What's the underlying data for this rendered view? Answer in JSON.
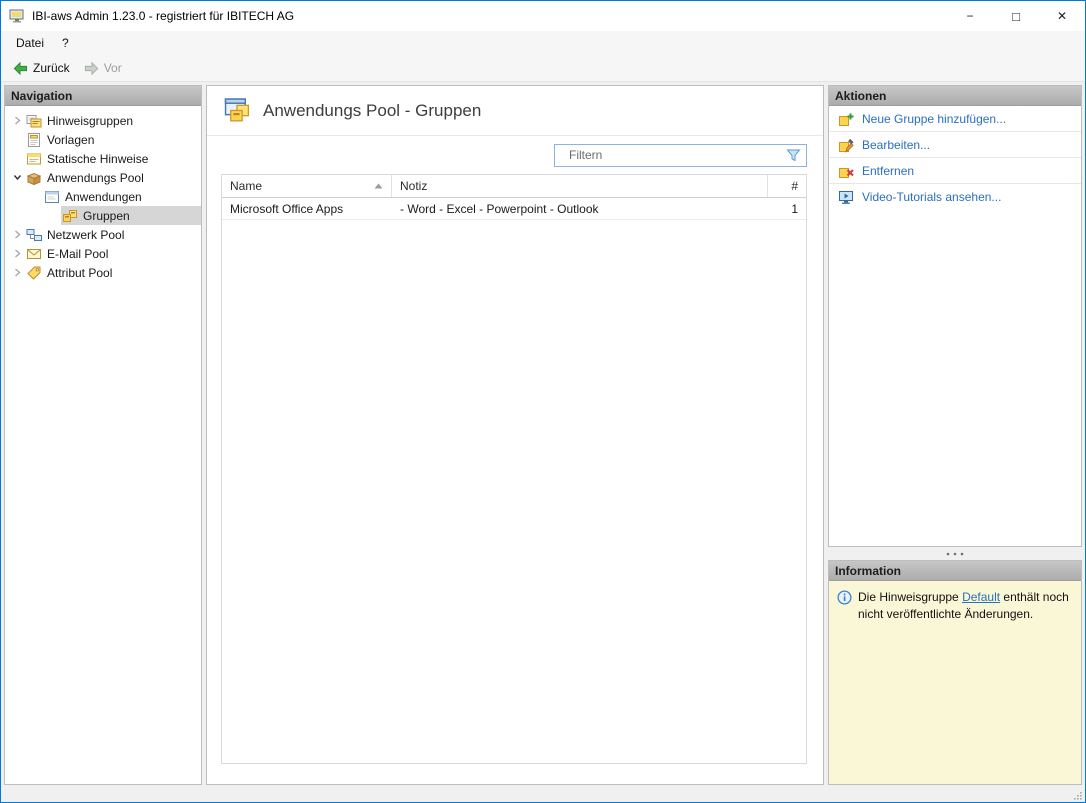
{
  "colors": {
    "window_border": "#0078d7",
    "panel_header_bg": "#b8b8b8",
    "selection_bg": "#d6d6d6",
    "link_blue": "#2a6fc0",
    "info_panel_bg": "#faf7d7",
    "back_arrow_green": "#3fae49",
    "filter_border_blue": "#8cb2dd"
  },
  "window": {
    "title": "IBI-aws Admin 1.23.0 - registriert für IBITECH AG",
    "controls": [
      {
        "name": "minimize",
        "glyph": "−"
      },
      {
        "name": "maximize",
        "glyph": "□"
      },
      {
        "name": "close",
        "glyph": "✕"
      }
    ]
  },
  "menubar": {
    "items": [
      {
        "label": "Datei"
      },
      {
        "label": "?"
      }
    ]
  },
  "toolbar": {
    "back_label": "Zurück",
    "forward_label": "Vor"
  },
  "navigation": {
    "header": "Navigation",
    "items": [
      {
        "label": "Hinweisgruppen",
        "icon": "notice-groups-icon",
        "expanded": false
      },
      {
        "label": "Vorlagen",
        "icon": "template-icon"
      },
      {
        "label": "Statische Hinweise",
        "icon": "static-notice-icon"
      },
      {
        "label": "Anwendungs Pool",
        "icon": "app-pool-icon",
        "expanded": true
      },
      {
        "label": "Anwendungen",
        "icon": "applications-icon"
      },
      {
        "label": "Gruppen",
        "icon": "groups-icon",
        "selected": true
      },
      {
        "label": "Netzwerk Pool",
        "icon": "network-pool-icon",
        "expanded": false
      },
      {
        "label": "E-Mail Pool",
        "icon": "email-pool-icon",
        "expanded": false
      },
      {
        "label": "Attribut Pool",
        "icon": "attribute-pool-icon",
        "expanded": false
      }
    ]
  },
  "main": {
    "title": "Anwendungs Pool - Gruppen",
    "title_icon": "groups-large-icon",
    "filter": {
      "placeholder": "Filtern",
      "icon": "filter-funnel-icon"
    },
    "table": {
      "columns": [
        "Name",
        "Notiz",
        "#"
      ],
      "sort": {
        "column": "Name",
        "direction": "ascending",
        "icon": "sort-ascending-icon"
      },
      "rows": [
        {
          "name": "Microsoft Office Apps",
          "notiz": "- Word - Excel - Powerpoint - Outlook",
          "count": "1"
        }
      ]
    }
  },
  "actions": {
    "header": "Aktionen",
    "items": [
      {
        "label": "Neue Gruppe hinzufügen...",
        "icon": "add-group-icon"
      },
      {
        "label": "Bearbeiten...",
        "icon": "edit-group-icon"
      },
      {
        "label": "Entfernen",
        "icon": "remove-group-icon"
      },
      {
        "label": "Video-Tutorials ansehen...",
        "icon": "video-tutorials-icon"
      }
    ]
  },
  "information": {
    "header": "Information",
    "icon": "info-icon",
    "text_before": "Die Hinweisgruppe ",
    "link_text": "Default",
    "text_after": " enthält noch nicht veröffentlichte Änderungen."
  }
}
